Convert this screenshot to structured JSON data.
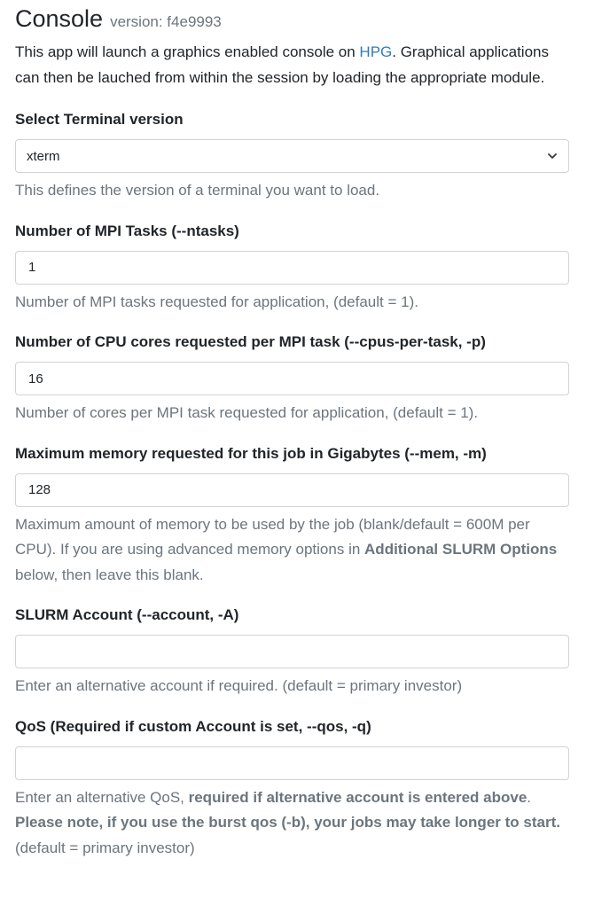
{
  "app": {
    "title": "Console",
    "version": "version: f4e9993",
    "intro_before": "This app will launch a graphics enabled console on ",
    "intro_link": "HPG",
    "intro_after": ". Graphical applications can then be lauched from within the session by loading the appropriate module."
  },
  "fields": {
    "terminal": {
      "label": "Select Terminal version",
      "value": "xterm",
      "help": "This defines the version of a terminal you want to load."
    },
    "ntasks": {
      "label": "Number of MPI Tasks (--ntasks)",
      "value": "1",
      "help": "Number of MPI tasks requested for application, (default = 1)."
    },
    "cpus": {
      "label": "Number of CPU cores requested per MPI task (--cpus-per-task, -p)",
      "value": "16",
      "help": "Number of cores per MPI task requested for application, (default = 1)."
    },
    "mem": {
      "label": "Maximum memory requested for this job in Gigabytes (--mem, -m)",
      "value": "128",
      "help_before": "Maximum amount of memory to be used by the job (blank/default = 600M per CPU). If you are using advanced memory options in ",
      "help_bold": "Additional SLURM Options",
      "help_after": " below, then leave this blank."
    },
    "account": {
      "label": "SLURM Account (--account, -A)",
      "value": "",
      "help": "Enter an alternative account if required. (default = primary investor)"
    },
    "qos": {
      "label": "QoS (Required if custom Account is set, --qos, -q)",
      "value": "",
      "help_before": "Enter an alternative QoS, ",
      "help_bold1": "required if alternative account is entered above",
      "help_mid": ". ",
      "help_bold2": "Please note, if you use the burst qos (-b), your jobs may take longer to start.",
      "help_after": " (default = primary investor)"
    }
  }
}
